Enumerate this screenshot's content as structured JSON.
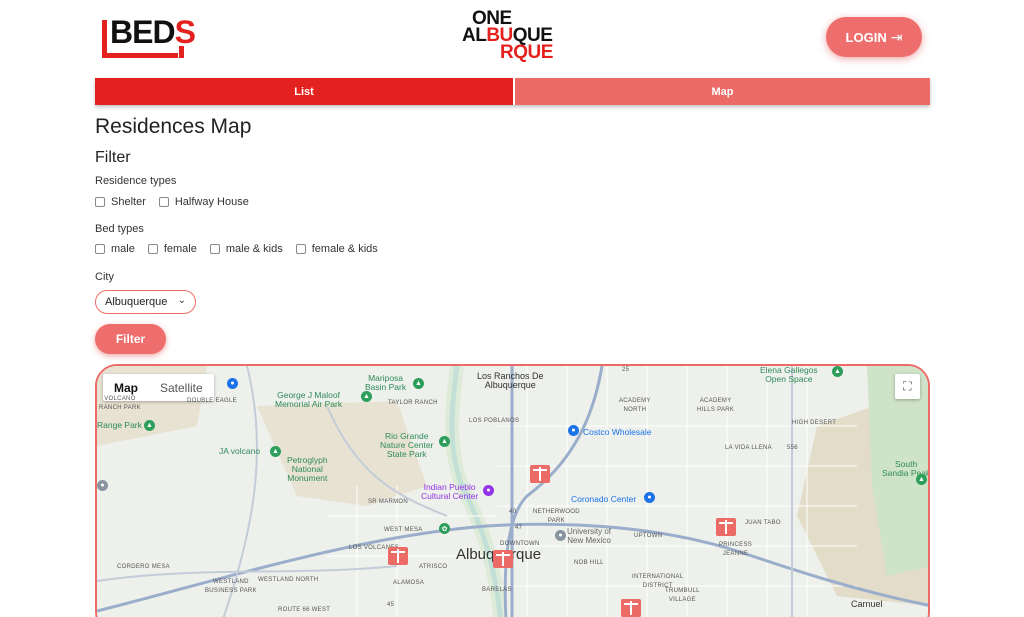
{
  "header": {
    "logo_left": {
      "part1": "BED",
      "part2": "S"
    },
    "logo_center": {
      "line1": "ONE",
      "line2_a": "AL",
      "line2_b": "BU",
      "line2_c": "QUE",
      "line3": "RQUE"
    },
    "login_label": "LOGIN",
    "login_icon": "login-arrow-icon"
  },
  "tabs": [
    {
      "label": "List"
    },
    {
      "label": "Map"
    }
  ],
  "page": {
    "title": "Residences Map",
    "filter_title": "Filter",
    "residence_types_label": "Residence types",
    "residence_types": [
      "Shelter",
      "Halfway House"
    ],
    "bed_types_label": "Bed types",
    "bed_types": [
      "male",
      "female",
      "male & kids",
      "female & kids"
    ],
    "city_label": "City",
    "city_value": "Albuquerque",
    "filter_button": "Filter"
  },
  "map": {
    "toggle": [
      "Map",
      "Satellite"
    ],
    "labels": {
      "los_ranchos": "Los Ranchos De\nAlbuquerque",
      "mariposa": "Mariposa\nBasin Park",
      "george": "George J Maloof\nMemorial Air Park",
      "elena": "Elena Gallegos\nOpen Space",
      "taylor_ranch": "TAYLOR RANCH",
      "volcano_ranch": "VOLCANO\nRANCH PARK",
      "double_eagle": "DOUBLE EAGLE",
      "range_park": "Range Park",
      "jaa_volcano": "JA volcano",
      "petroglyph": "Petroglyph\nNational\nMonument",
      "rio_grande": "Rio Grande\nNature Center\nState Park",
      "los_poblanos": "LOS POBLANOS",
      "costco": "Costco Wholesale",
      "academy": "ACADEMY\nHILLS PARK",
      "academy_north": "ACADEMY\nNORTH",
      "high_desert": "HIGH DESERT",
      "la_vida": "LA VIDA LLENA",
      "south_sandia": "South\nSandia Peak",
      "indian_pueblo": "Indian Pueblo\nCultural Center",
      "coronado": "Coronado Center",
      "sr_marmon": "SR MARMON",
      "netherwood": "NETHERWOOD\nPARK",
      "juan_tabo": "JUAN TABO",
      "west_mesa": "WEST MESA",
      "unm": "University of\nNew Mexico",
      "uptown": "UPTOWN",
      "princess_jeanne": "PRINCESS\nJEANNE",
      "los_volcanes": "LOS VOLCANES",
      "downtown": "DOWNTOWN",
      "albuquerque": "Albuquerque",
      "cordero": "CORDERO MESA",
      "atrisco": "ATRISCO",
      "nob_hill": "NOB HILL",
      "westland": "WESTLAND\nBUSINESS PARK",
      "westland_north": "WESTLAND NORTH",
      "alamosa": "ALAMOSA",
      "intl_district": "INTERNATIONAL\nDISTRICT",
      "trumbull": "TRUMBULL\nVILLAGE",
      "route66": "ROUTE 66 WEST",
      "barelas": "BARELAS",
      "carnuel": "Carnuel",
      "route_25": "25",
      "route_47": "47",
      "route_40": "40",
      "route_45": "45",
      "route_556": "556"
    }
  }
}
